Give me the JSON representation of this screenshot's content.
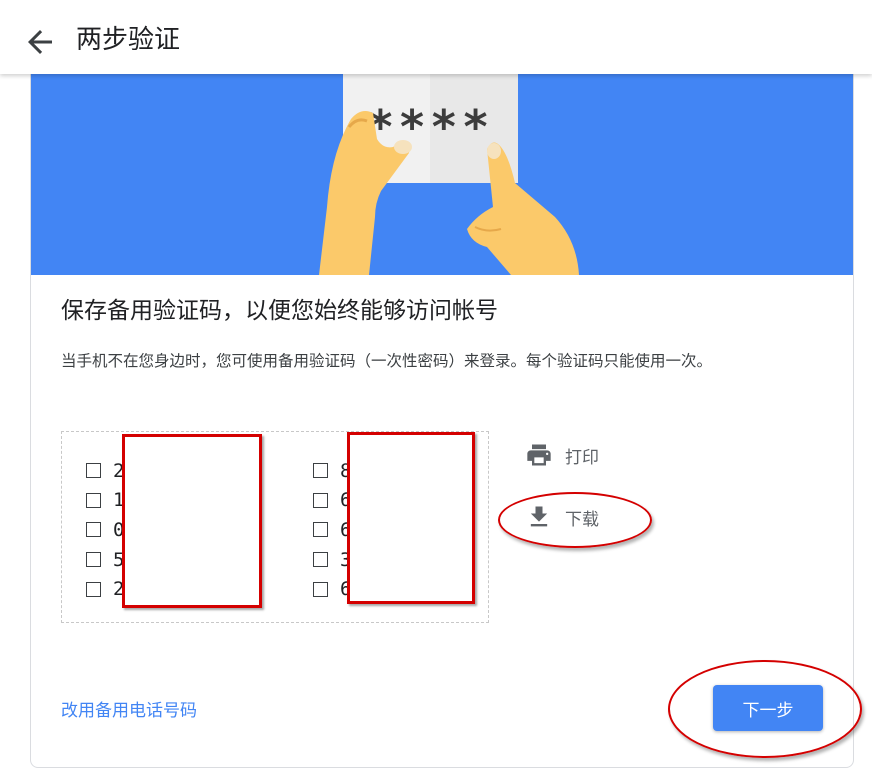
{
  "header": {
    "back_icon": "arrow-left-icon",
    "title": "两步验证"
  },
  "hero": {
    "card_text": "****",
    "colors": {
      "background": "#4285f4",
      "hand": "#fbc96a",
      "card": "#f1f1f1"
    }
  },
  "content": {
    "heading": "保存备用验证码，以便您始终能够访问帐号",
    "description": "当手机不在您身边时，您可使用备用验证码（一次性密码）来登录。每个验证码只能使用一次。"
  },
  "codes": {
    "left": [
      "2",
      "1",
      "0",
      "5",
      "2"
    ],
    "right": [
      "8",
      "6",
      "6",
      "3",
      "6"
    ]
  },
  "actions": {
    "print": {
      "label": "打印",
      "icon": "printer-icon"
    },
    "download": {
      "label": "下载",
      "icon": "download-icon"
    }
  },
  "footer": {
    "alt_link": "改用备用电话号码",
    "next_label": "下一步"
  },
  "colors": {
    "accent": "#4285f4",
    "annotation_red": "#d40000"
  }
}
